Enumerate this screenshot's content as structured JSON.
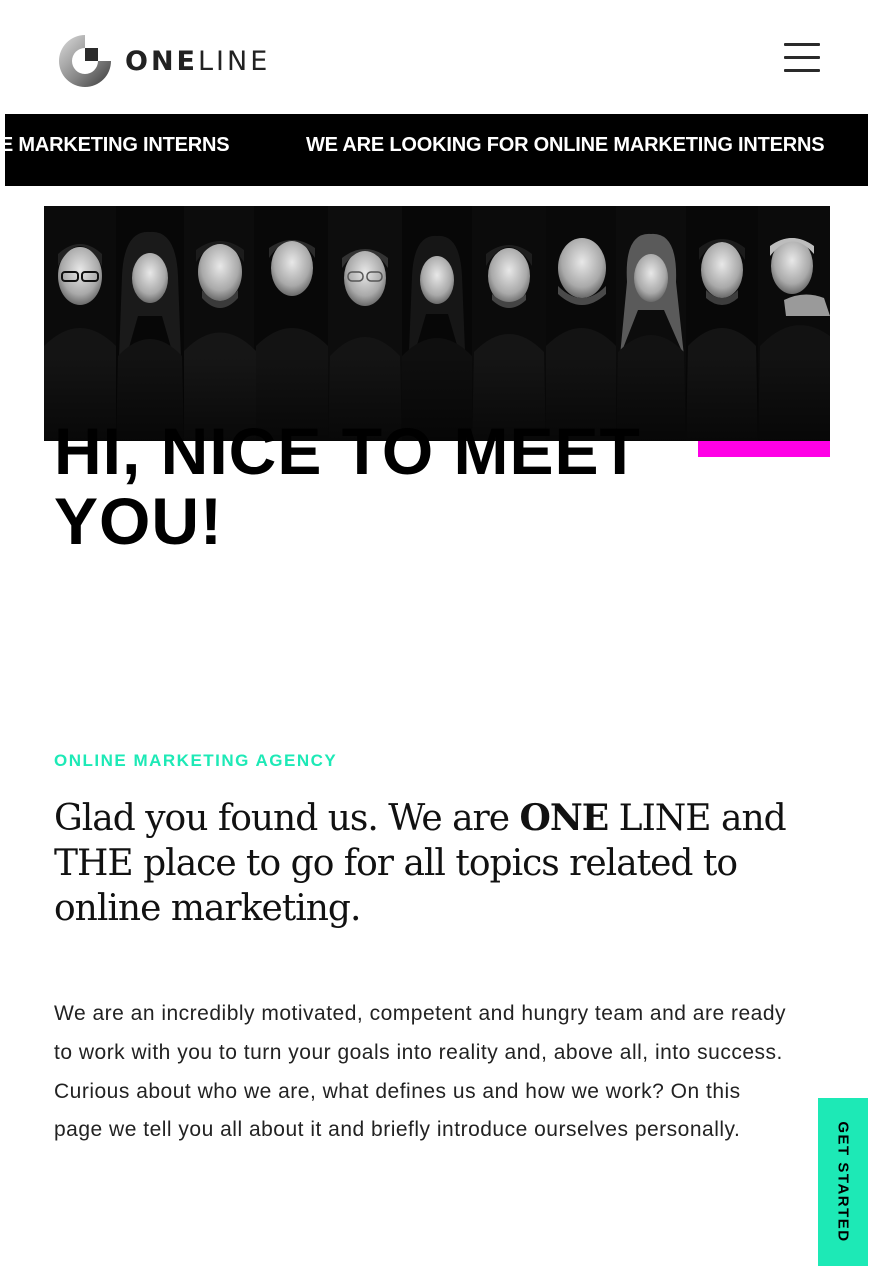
{
  "header": {
    "logo_bold": "ONE",
    "logo_light": "LINE",
    "menu_icon": "hamburger-icon"
  },
  "ticker": {
    "items": [
      "WE ARE LOOKING FOR ONLINE MARKETING INTERNS",
      "WE ARE LOOKING FOR ONLINE MARKETING INTERNS"
    ]
  },
  "hero": {
    "headline": "HI, NICE TO MEET YOU!",
    "image_alt": "team portrait",
    "accent_color": "#ff00e6"
  },
  "intro": {
    "eyebrow": "ONLINE MARKETING AGENCY",
    "lead_before": "Glad you found us. We are ",
    "lead_bold": "ONE",
    "lead_after": " LINE and THE place to go for all topics related to online marketing.",
    "body": "We are an incredibly motivated, competent and hungry team and are ready to work with you to turn your goals into reality and, above all, into success. Curious about who we are, what defines us and how we work? On this page we tell you all about it and briefly introduce ourselves personally."
  },
  "cta": {
    "label": "GET STARTED",
    "color": "#1de9b6"
  }
}
